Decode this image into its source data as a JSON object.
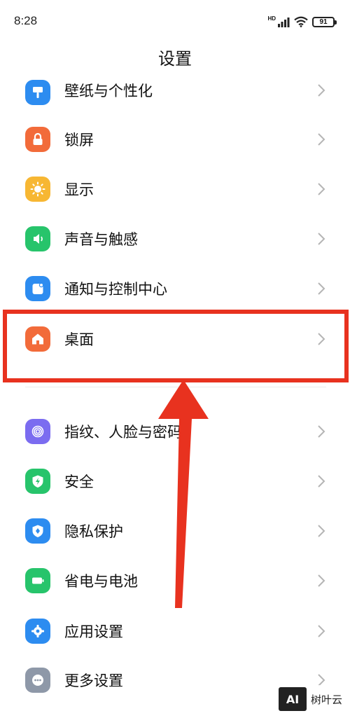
{
  "status_bar": {
    "time": "8:28",
    "network_badge": "HD",
    "signal_icon": "signal-bars-icon",
    "wifi_icon": "wifi-icon",
    "battery_level": "91"
  },
  "header": {
    "title": "设置"
  },
  "settings_items": [
    {
      "label": "壁纸与个性化",
      "icon": "wallpaper-brush-icon",
      "color": "#2d8cf0"
    },
    {
      "label": "锁屏",
      "icon": "lock-icon",
      "color": "#f26b3a"
    },
    {
      "label": "显示",
      "icon": "sun-icon",
      "color": "#f7b733"
    },
    {
      "label": "声音与触感",
      "icon": "speaker-icon",
      "color": "#27c46b"
    },
    {
      "label": "通知与控制中心",
      "icon": "notification-icon",
      "color": "#2d8cf0"
    },
    {
      "label": "桌面",
      "icon": "home-icon",
      "color": "#f26b3a"
    },
    {
      "label": "指纹、人脸与密码",
      "icon": "fingerprint-icon",
      "color": "#7b6cf0"
    },
    {
      "label": "安全",
      "icon": "shield-bolt-icon",
      "color": "#27c46b"
    },
    {
      "label": "隐私保护",
      "icon": "privacy-shield-icon",
      "color": "#2d8cf0"
    },
    {
      "label": "省电与电池",
      "icon": "battery-icon",
      "color": "#27c46b"
    },
    {
      "label": "应用设置",
      "icon": "gear-icon",
      "color": "#2d8cf0"
    },
    {
      "label": "更多设置",
      "icon": "more-dots-icon",
      "color": "#8e98a8"
    }
  ],
  "annotation": {
    "highlight_color": "#e8321f"
  },
  "watermark": {
    "logo_text": "AI",
    "text": "树叶云"
  }
}
